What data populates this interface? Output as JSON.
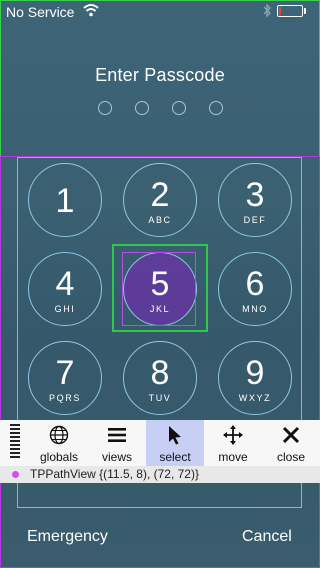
{
  "status_bar": {
    "carrier": "No Service",
    "battery_level": 0.1
  },
  "passcode": {
    "title": "Enter Passcode",
    "entered_digits": 0,
    "total_digits": 4
  },
  "keypad": [
    {
      "digit": "1",
      "letters": ""
    },
    {
      "digit": "2",
      "letters": "ABC"
    },
    {
      "digit": "3",
      "letters": "DEF"
    },
    {
      "digit": "4",
      "letters": "GHI"
    },
    {
      "digit": "5",
      "letters": "JKL"
    },
    {
      "digit": "6",
      "letters": "MNO"
    },
    {
      "digit": "7",
      "letters": "PQRS"
    },
    {
      "digit": "8",
      "letters": "TUV"
    },
    {
      "digit": "9",
      "letters": "WXYZ"
    }
  ],
  "toolbar": {
    "items": [
      {
        "label": "globals",
        "icon": "globe-icon",
        "active": false
      },
      {
        "label": "views",
        "icon": "hamburger-icon",
        "active": false
      },
      {
        "label": "select",
        "icon": "cursor-arrow-icon",
        "active": true
      },
      {
        "label": "move",
        "icon": "move-arrows-icon",
        "active": false
      },
      {
        "label": "close",
        "icon": "close-icon",
        "active": false
      }
    ]
  },
  "inspector": {
    "selection_text": "TPPathView {(11.5, 8), (72, 72)}",
    "dot_color": "#d44ff0"
  },
  "bottom": {
    "left_label": "Emergency",
    "right_label": "Cancel"
  },
  "colors": {
    "accent_selection": "#6c2faa",
    "outline_green": "#38d14a",
    "outline_purple": "#b637e0",
    "outline_orange": "#f0a32a"
  }
}
